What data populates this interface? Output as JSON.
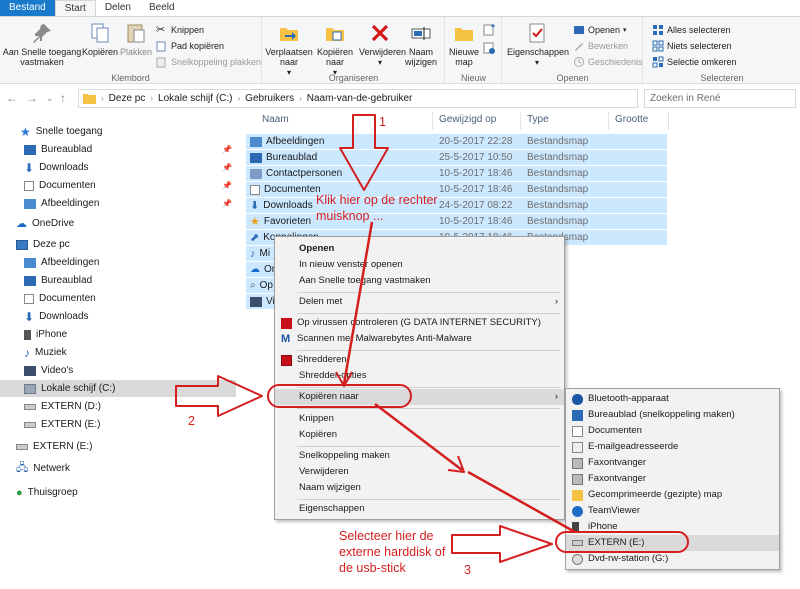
{
  "ribbon_tabs": [
    "Bestand",
    "Start",
    "Delen",
    "Beeld"
  ],
  "groups": {
    "klembord": {
      "label": "Klembord",
      "pin": "Aan Snelle toegang vastmaken",
      "copy": "Kopiëren",
      "paste": "Plakken",
      "cut": "Knippen",
      "copy_path": "Pad kopiëren",
      "paste_shortcut": "Snelkoppeling plakken"
    },
    "organiseren": {
      "label": "Organiseren",
      "move": "Verplaatsen naar",
      "copy_to": "Kopiëren naar",
      "delete": "Verwijderen",
      "rename": "Naam wijzigen"
    },
    "nieuw": {
      "label": "Nieuw",
      "new_folder": "Nieuwe map"
    },
    "openen": {
      "label": "Openen",
      "properties": "Eigenschappen",
      "open": "Openen",
      "edit": "Bewerken",
      "history": "Geschiedenis"
    },
    "selecteren": {
      "label": "Selecteren",
      "select_all": "Alles selecteren",
      "select_none": "Niets selecteren",
      "invert": "Selectie omkeren"
    }
  },
  "address": {
    "crumbs": [
      "Deze pc",
      "Lokale schijf (C:)",
      "Gebruikers",
      "Naam-van-de-gebruiker"
    ],
    "search_placeholder": "Zoeken in René"
  },
  "nav": {
    "quick_access": "Snelle toegang",
    "quick_items": [
      "Bureaublad",
      "Downloads",
      "Documenten",
      "Afbeeldingen"
    ],
    "onedrive": "OneDrive",
    "this_pc": "Deze pc",
    "pc_items": [
      "Afbeeldingen",
      "Bureaublad",
      "Documenten",
      "Downloads",
      "iPhone",
      "Muziek",
      "Video's",
      "Lokale schijf (C:)",
      "EXTERN (D:)",
      "EXTERN (E:)"
    ],
    "extern": "EXTERN (E:)",
    "network": "Netwerk",
    "homegroup": "Thuisgroep"
  },
  "columns": [
    "Naam",
    "Gewijzigd op",
    "Type",
    "Grootte"
  ],
  "files": [
    {
      "name": "Afbeeldingen",
      "date": "20-5-2017 22:28",
      "type": "Bestandsmap"
    },
    {
      "name": "Bureaublad",
      "date": "25-5-2017 10:50",
      "type": "Bestandsmap"
    },
    {
      "name": "Contactpersonen",
      "date": "10-5-2017 18:46",
      "type": "Bestandsmap"
    },
    {
      "name": "Documenten",
      "date": "10-5-2017 18:46",
      "type": "Bestandsmap"
    },
    {
      "name": "Downloads",
      "date": "24-5-2017 08:22",
      "type": "Bestandsmap"
    },
    {
      "name": "Favorieten",
      "date": "10-5-2017 18:46",
      "type": "Bestandsmap"
    },
    {
      "name": "Koppelingen",
      "date": "10-5-2017 18:46",
      "type": "Bestandsmap"
    },
    {
      "name": "Mi",
      "date": "",
      "type": ""
    },
    {
      "name": "On",
      "date": "",
      "type": ""
    },
    {
      "name": "Op",
      "date": "",
      "type": ""
    },
    {
      "name": "Vid",
      "date": "",
      "type": ""
    }
  ],
  "context_menu": [
    "Openen",
    "In nieuw venster openen",
    "Aan Snelle toegang vastmaken",
    "Delen met",
    "Op virussen controleren (G DATA INTERNET SECURITY)",
    "Scannen met Malwarebytes Anti-Malware",
    "Shredderen",
    "Shredder-opties",
    "Kopiëren naar",
    "Knippen",
    "Kopiëren",
    "Snelkoppeling maken",
    "Verwijderen",
    "Naam wijzigen",
    "Eigenschappen"
  ],
  "submenu": [
    "Bluetooth-apparaat",
    "Bureaublad (snelkoppeling maken)",
    "Documenten",
    "E-mailgeadresseerde",
    "Faxontvanger",
    "Faxontvanger",
    "Gecomprimeerde (gezipte) map",
    "TeamViewer",
    "iPhone",
    "EXTERN (E:)",
    "Dvd-rw-station (G:)"
  ],
  "annotations": {
    "step1_num": "1",
    "step1_l1": "Klik hier op de rechter",
    "step1_l2": "muisknop ...",
    "step2_num": "2",
    "step3_l1": "Selecteer hier de",
    "step3_l2": "externe harddisk of",
    "step3_l3": "de usb-stick",
    "step3_num": "3"
  },
  "colors": {
    "accent": "#1979ca",
    "selection": "#cce8ff",
    "annotation": "#d41f1f"
  }
}
